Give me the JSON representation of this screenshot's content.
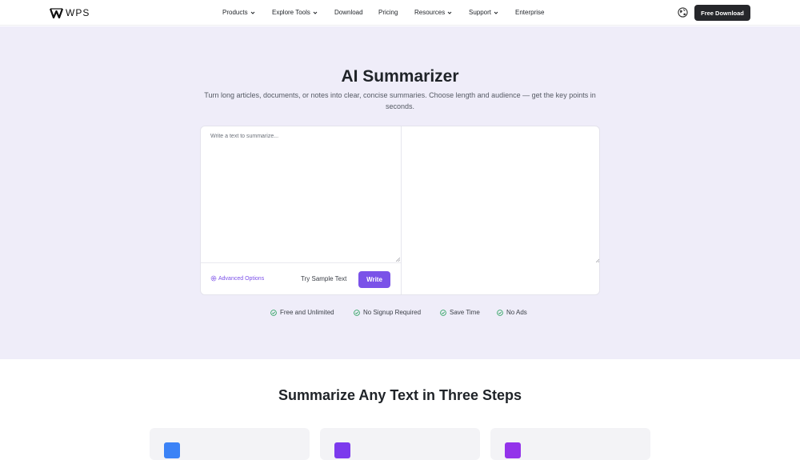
{
  "header": {
    "logo_text": "WPS",
    "nav": [
      {
        "label": "Products",
        "has_dropdown": true
      },
      {
        "label": "Explore Tools",
        "has_dropdown": true
      },
      {
        "label": "Download",
        "has_dropdown": false
      },
      {
        "label": "Pricing",
        "has_dropdown": false
      },
      {
        "label": "Resources",
        "has_dropdown": true
      },
      {
        "label": "Support",
        "has_dropdown": true
      },
      {
        "label": "Enterprise",
        "has_dropdown": false
      }
    ],
    "language_icon": "globe-icon",
    "cta_label": "Free Download"
  },
  "hero": {
    "title": "AI Summarizer",
    "subtitle": "Turn long articles, documents, or notes into clear, concise summaries. Choose length and audience — get the key points in seconds.",
    "input_placeholder": "Write a text to summarize...",
    "output_value": "",
    "advanced_label": "Advanced Options",
    "sample_label": "Try Sample Text",
    "write_label": "Write"
  },
  "features": [
    {
      "label": "Free and Unlimited"
    },
    {
      "label": "No Signup Required"
    },
    {
      "label": "Save Time"
    },
    {
      "label": "No Ads"
    }
  ],
  "steps": {
    "title": "Summarize Any Text in Three Steps",
    "cards": [
      {
        "badge_color": "#3b82f6"
      },
      {
        "badge_color": "#7c3aed"
      },
      {
        "badge_color": "#9333ea"
      }
    ]
  },
  "colors": {
    "hero_bg": "#efedf9",
    "accent": "#7a52e8",
    "check_green": "#1f9d55",
    "dark_button": "#26272b"
  }
}
